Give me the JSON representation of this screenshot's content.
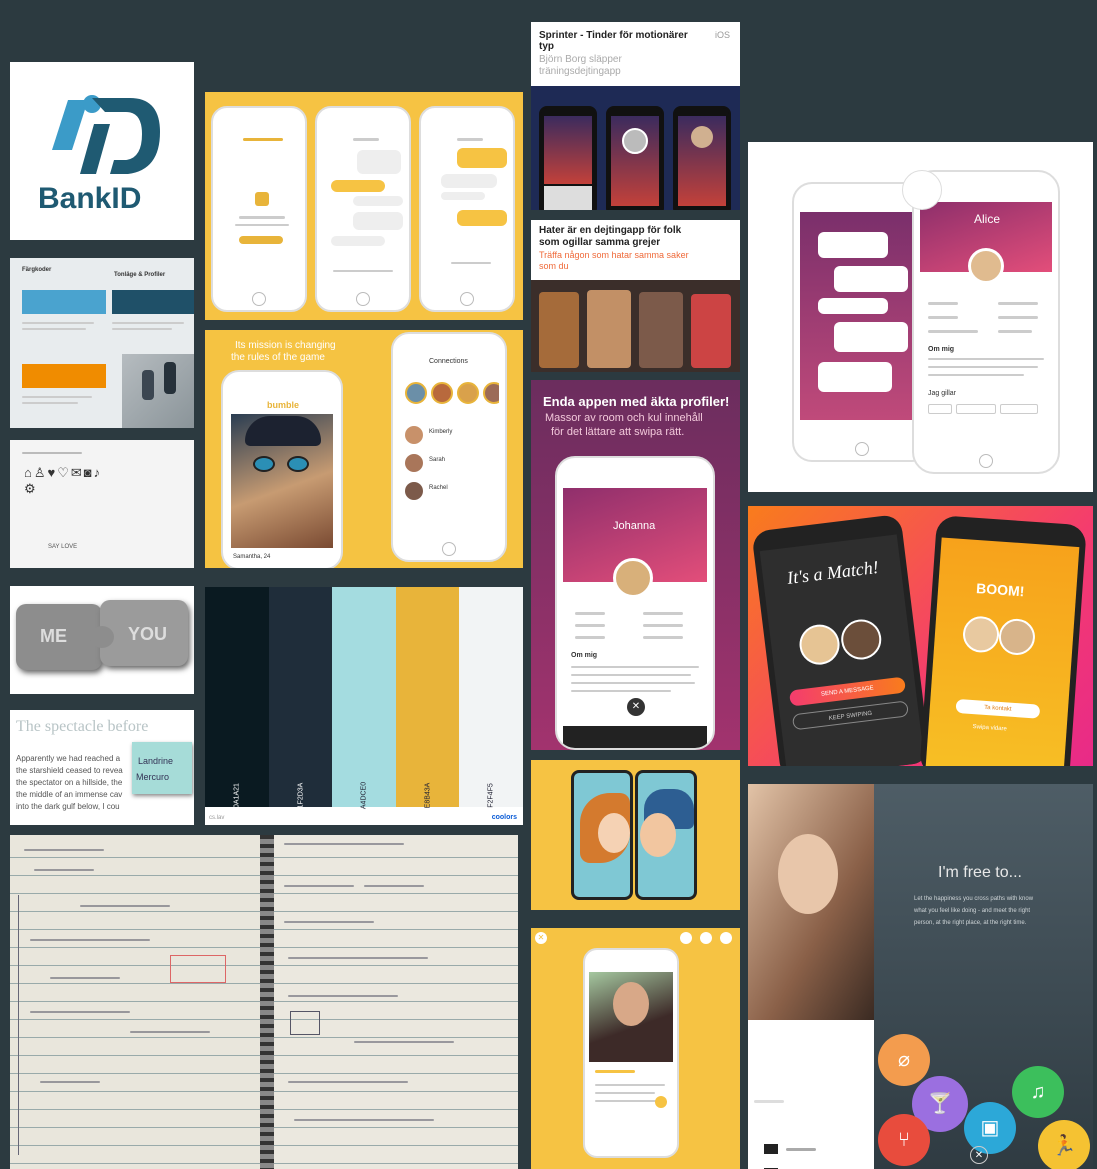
{
  "bankid": {
    "text": "BankID"
  },
  "palette_card": {
    "label_left": "Färgkoder",
    "label_right": "Tonläge & Profiler",
    "color_a": "#4aa3cf",
    "color_b": "#1f5068",
    "color_c": "#f08c00"
  },
  "icons_card": {
    "caption": "SAY LOVE"
  },
  "puzzle": {
    "left": "ME",
    "right": "YOU"
  },
  "story": {
    "heading": "The spectacle before",
    "body_lines": [
      "Apparently we had reached a",
      "the starshield ceased to revea",
      "the spectator on a hillside, the",
      "the middle of an immense cav",
      "into the dark gulf below, I cou"
    ],
    "sticky": [
      "Landrine",
      "Mercuro"
    ]
  },
  "bumble": {
    "headline_1": "Its mission is changing",
    "headline_2": "the rules of the game",
    "logo": "bumble",
    "profile_name": "Samantha, 24",
    "connections_title": "Connections",
    "rows": [
      "Kimberly",
      "Sarah",
      "Rachel"
    ]
  },
  "swatches": [
    {
      "hex": "#0A1A21",
      "label": "0A1A21"
    },
    {
      "hex": "#1F2D3A",
      "label": "1F2D3A"
    },
    {
      "hex": "#A4DCE0",
      "label": "A4DCE0"
    },
    {
      "hex": "#E8B43A",
      "label": "E8B43A"
    },
    {
      "hex": "#F2F4F5",
      "label": "F2F4F5"
    }
  ],
  "swatches_footer": {
    "left": "cs.lav",
    "right": "coolors"
  },
  "sprinter": {
    "title": "Sprinter - Tinder för motionärer typ",
    "platform": "iOS",
    "subtitle_1": "Björn Borg släpper",
    "subtitle_2": "träningsdejtingapp"
  },
  "hater": {
    "title_1": "Hater är en dejtingapp för folk",
    "title_2": "som ogillar samma grejer",
    "subtitle_1": "Träffa någon som hatar samma saker",
    "subtitle_2": "som du"
  },
  "enda": {
    "headline": "Enda appen med äkta profiler!",
    "sub_1": "Massor av room och kul innehåll",
    "sub_2": "för det lättare att swipa rätt.",
    "profile_name": "Johanna",
    "section": "Om mig"
  },
  "alice": {
    "name": "Alice",
    "section": "Om mig",
    "likes": "Jag gillar"
  },
  "match": {
    "title_1": "It's a",
    "title_2": "Match!",
    "btn_primary": "SEND A MESSAGE",
    "btn_secondary": "KEEP SWIPING",
    "boom": "BOOM!",
    "boom_btn": "Ta kontakt",
    "boom_link": "Swipa vidare"
  },
  "free": {
    "headline": "I'm free to...",
    "body_1": "Let the happiness you cross paths with know",
    "body_2": "what you feel like doing - and meet the right",
    "body_3": "person, at the right place, at the right time."
  }
}
